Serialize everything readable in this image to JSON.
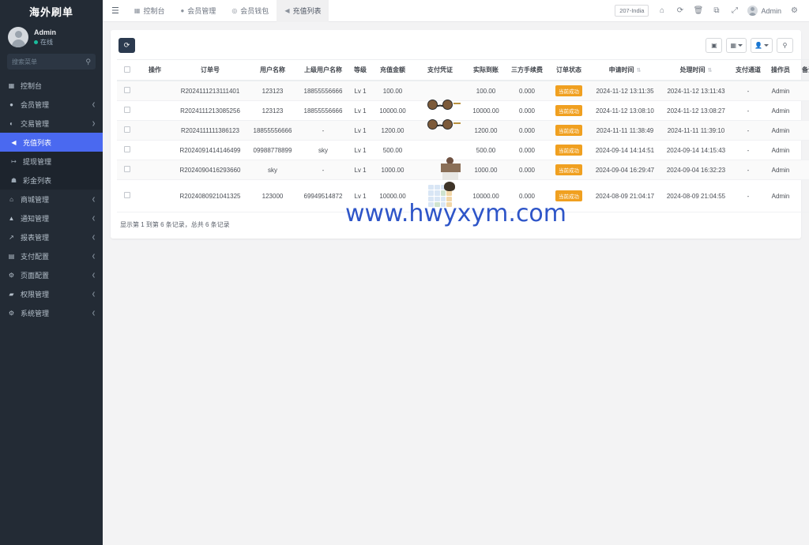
{
  "sidebar": {
    "brand": "海外刷单",
    "user": {
      "name": "Admin",
      "status": "在线"
    },
    "search": {
      "placeholder": "搜索菜单",
      "value": "",
      "icon": "search-icon"
    },
    "items": [
      {
        "label": "控制台",
        "icon": "dashboard-icon",
        "arrow": "",
        "level": "top",
        "active": false
      },
      {
        "label": "会员管理",
        "icon": "user-icon",
        "arrow": "❮",
        "level": "top",
        "active": false
      },
      {
        "label": "交易管理",
        "icon": "coin-icon",
        "arrow": "❯",
        "level": "top",
        "active": false
      },
      {
        "label": "充值列表",
        "icon": "megaphone-icon",
        "arrow": "",
        "level": "sub",
        "active": true
      },
      {
        "label": "提现管理",
        "icon": "withdraw-icon",
        "arrow": "",
        "level": "sub",
        "active": false
      },
      {
        "label": "彩金列表",
        "icon": "gift-icon",
        "arrow": "",
        "level": "sub",
        "active": false
      },
      {
        "label": "商城管理",
        "icon": "store-icon",
        "arrow": "❮",
        "level": "top",
        "active": false
      },
      {
        "label": "通知管理",
        "icon": "bell-icon",
        "arrow": "❮",
        "level": "top",
        "active": false
      },
      {
        "label": "报表管理",
        "icon": "chart-icon",
        "arrow": "❮",
        "level": "top",
        "active": false
      },
      {
        "label": "支付配置",
        "icon": "card-icon",
        "arrow": "❮",
        "level": "top",
        "active": false
      },
      {
        "label": "页面配置",
        "icon": "gear-icon",
        "arrow": "❮",
        "level": "top",
        "active": false
      },
      {
        "label": "权限管理",
        "icon": "shield-icon",
        "arrow": "❮",
        "level": "top",
        "active": false
      },
      {
        "label": "系统管理",
        "icon": "tools-icon",
        "arrow": "❮",
        "level": "top",
        "active": false
      }
    ]
  },
  "topbar": {
    "menu_toggle_icon": "hamburger-icon",
    "tabs": [
      {
        "label": "控制台",
        "icon": "dashboard-icon",
        "active": false
      },
      {
        "label": "会员管理",
        "icon": "user-icon",
        "active": false
      },
      {
        "label": "会员钱包",
        "icon": "wallet-icon",
        "active": false
      },
      {
        "label": "充值列表",
        "icon": "megaphone-icon",
        "active": true
      }
    ],
    "env_badge": "207-India",
    "icons": [
      {
        "name": "home-icon",
        "glyph": "⌂"
      },
      {
        "name": "refresh-icon",
        "glyph": "⟳"
      },
      {
        "name": "trash-icon",
        "glyph": "🗑"
      },
      {
        "name": "copy-icon",
        "glyph": "⧉"
      },
      {
        "name": "fullscreen-icon",
        "glyph": "⤢"
      }
    ],
    "user_label": "Admin",
    "settings_icon": "gear-icon"
  },
  "toolbar": {
    "refresh_icon": "refresh-icon",
    "buttons": [
      {
        "name": "export-button",
        "glyph": "▣",
        "caret": false
      },
      {
        "name": "columns-button",
        "glyph": "▦",
        "caret": true
      },
      {
        "name": "person-button",
        "glyph": "👤",
        "caret": true
      },
      {
        "name": "search-button",
        "glyph": "⌕",
        "caret": false
      }
    ]
  },
  "table": {
    "columns": [
      {
        "key": "check",
        "label": "",
        "sortable": false
      },
      {
        "key": "action",
        "label": "操作",
        "sortable": false
      },
      {
        "key": "order_no",
        "label": "订单号",
        "sortable": false
      },
      {
        "key": "username",
        "label": "用户名称",
        "sortable": false
      },
      {
        "key": "parent",
        "label": "上级用户名称",
        "sortable": false
      },
      {
        "key": "level",
        "label": "等级",
        "sortable": false
      },
      {
        "key": "amount",
        "label": "充值金额",
        "sortable": false
      },
      {
        "key": "proof",
        "label": "支付凭证",
        "sortable": false
      },
      {
        "key": "received",
        "label": "实际到账",
        "sortable": false
      },
      {
        "key": "fee",
        "label": "三方手续费",
        "sortable": false
      },
      {
        "key": "status",
        "label": "订单状态",
        "sortable": false
      },
      {
        "key": "apply_time",
        "label": "申请时间",
        "sortable": true
      },
      {
        "key": "deal_time",
        "label": "处理时间",
        "sortable": true
      },
      {
        "key": "channel",
        "label": "支付通道",
        "sortable": false
      },
      {
        "key": "operator",
        "label": "操作员",
        "sortable": false
      },
      {
        "key": "remark",
        "label": "备注",
        "sortable": false
      }
    ],
    "rows": [
      {
        "order_no": "R2024111213111401",
        "username": "123123",
        "parent": "18855556666",
        "level": "Lv 1",
        "amount": "100.00",
        "proof": "glasses",
        "received": "100.00",
        "fee": "0.000",
        "status": "当前成功",
        "apply_time": "2024-11-12 13:11:35",
        "deal_time": "2024-11-12 13:11:43",
        "channel": "-",
        "operator": "Admin",
        "remark": ""
      },
      {
        "order_no": "R2024111213085256",
        "username": "123123",
        "parent": "18855556666",
        "level": "Lv 1",
        "amount": "10000.00",
        "proof": "glasses",
        "received": "10000.00",
        "fee": "0.000",
        "status": "当前成功",
        "apply_time": "2024-11-12 13:08:10",
        "deal_time": "2024-11-12 13:08:27",
        "channel": "-",
        "operator": "Admin",
        "remark": ""
      },
      {
        "order_no": "R2024111111386123",
        "username": "18855556666",
        "parent": "-",
        "level": "Lv 1",
        "amount": "1200.00",
        "proof": "none",
        "received": "1200.00",
        "fee": "0.000",
        "status": "当前成功",
        "apply_time": "2024-11-11 11:38:49",
        "deal_time": "2024-11-11 11:39:10",
        "channel": "-",
        "operator": "Admin",
        "remark": ""
      },
      {
        "order_no": "R2024091414146499",
        "username": "09988778899",
        "parent": "sky",
        "level": "Lv 1",
        "amount": "500.00",
        "proof": "photo1",
        "received": "500.00",
        "fee": "0.000",
        "status": "当前成功",
        "apply_time": "2024-09-14 14:14:51",
        "deal_time": "2024-09-14 14:15:43",
        "channel": "-",
        "operator": "Admin",
        "remark": ""
      },
      {
        "order_no": "R2024090416293660",
        "username": "sky",
        "parent": "-",
        "level": "Lv 1",
        "amount": "1000.00",
        "proof": "photo2",
        "received": "1000.00",
        "fee": "0.000",
        "status": "当前成功",
        "apply_time": "2024-09-04 16:29:47",
        "deal_time": "2024-09-04 16:32:23",
        "channel": "-",
        "operator": "Admin",
        "remark": ""
      },
      {
        "order_no": "R2024080921041325",
        "username": "123000",
        "parent": "69949514872",
        "level": "Lv 1",
        "amount": "10000.00",
        "proof": "grid",
        "received": "10000.00",
        "fee": "0.000",
        "status": "当前成功",
        "apply_time": "2024-08-09 21:04:17",
        "deal_time": "2024-08-09 21:04:55",
        "channel": "-",
        "operator": "Admin",
        "remark": ""
      }
    ],
    "footer": "显示第 1 到第 6 条记录，总共 6 条记录"
  },
  "watermark": "www.hwyxym.com",
  "colors": {
    "accent": "#4a69f0",
    "sidebar": "#232b35",
    "status_badge": "#f0a020",
    "watermark": "#2e55c8"
  }
}
